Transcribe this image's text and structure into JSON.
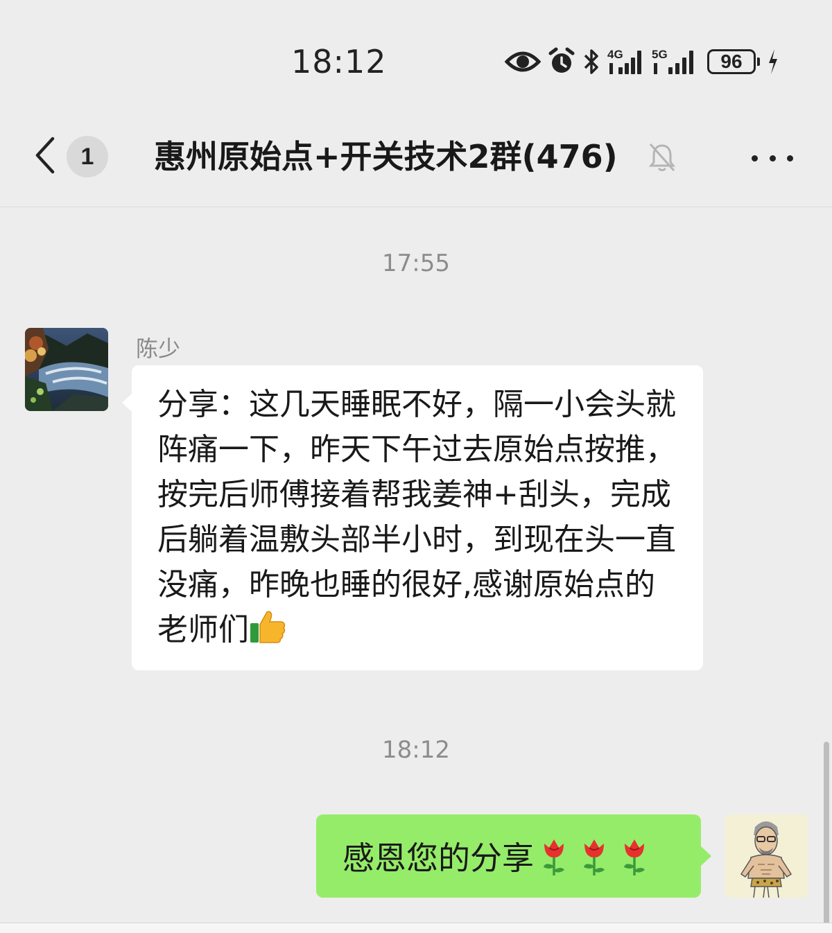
{
  "status_bar": {
    "time": "18:12",
    "network_1": "4G",
    "network_2": "5G",
    "battery": "96",
    "icons": [
      "eye-icon",
      "alarm-icon",
      "bluetooth-icon",
      "signal-4g-icon",
      "signal-5g-icon",
      "battery-icon",
      "charging-icon"
    ]
  },
  "header": {
    "back_icon": "chevron-left-icon",
    "unread_count": "1",
    "title": "惠州原始点+开关技术2群(476)",
    "mute_icon": "bell-muted-icon",
    "more_icon": "more-dots-icon"
  },
  "messages": [
    {
      "timestamp": "17:55",
      "sender": "陈少",
      "direction": "incoming",
      "text": "分享：这几天睡眠不好，隔一小会头就阵痛一下，昨天下午过去原始点按推，按完后师傅接着帮我姜神+刮头，完成后躺着温敷头部半小时，到现在头一直没痛，昨晚也睡的很好,感谢原始点的老师们",
      "emoji": "thumbs-up-icon"
    },
    {
      "timestamp": "18:12",
      "direction": "outgoing",
      "text": "感恩您的分享",
      "emoji": [
        "rose-icon",
        "rose-icon",
        "rose-icon"
      ]
    }
  ],
  "colors": {
    "background": "#ededed",
    "incoming_bubble": "#ffffff",
    "outgoing_bubble": "#95ec69",
    "timestamp_text": "#8c8c8c"
  }
}
